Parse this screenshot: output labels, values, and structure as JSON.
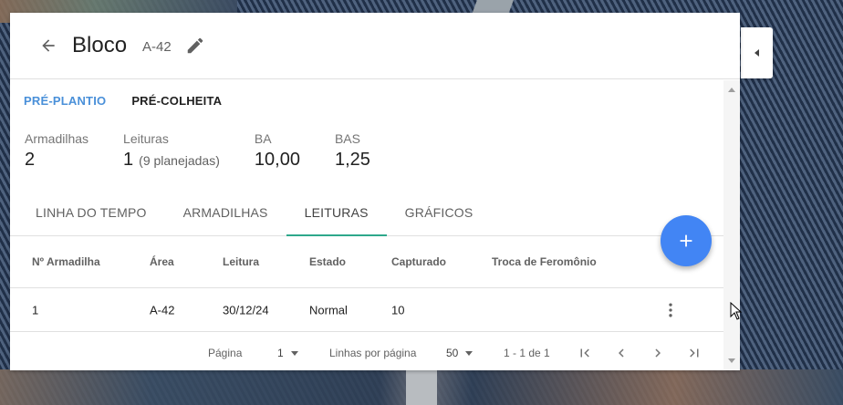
{
  "header": {
    "title": "Bloco",
    "code": "A-42"
  },
  "phase_tabs": [
    {
      "label": "PRÉ-PLANTIO",
      "active": true
    },
    {
      "label": "PRÉ-COLHEITA",
      "active": false
    }
  ],
  "stats": [
    {
      "label": "Armadilhas",
      "value": "2",
      "note": ""
    },
    {
      "label": "Leituras",
      "value": "1",
      "note": "(9 planejadas)"
    },
    {
      "label": "BA",
      "value": "10,00",
      "note": ""
    },
    {
      "label": "BAS",
      "value": "1,25",
      "note": ""
    }
  ],
  "tabs": [
    {
      "label": "LINHA DO TEMPO",
      "active": false
    },
    {
      "label": "ARMADILHAS",
      "active": false
    },
    {
      "label": "LEITURAS",
      "active": true
    },
    {
      "label": "GRÁFICOS",
      "active": false
    }
  ],
  "table": {
    "columns": [
      "Nº Armadilha",
      "Área",
      "Leitura",
      "Estado",
      "Capturado",
      "Troca de Feromônio"
    ],
    "rows": [
      [
        "1",
        "A-42",
        "30/12/24",
        "Normal",
        "10",
        ""
      ]
    ]
  },
  "pagination": {
    "page_label": "Página",
    "page_value": "1",
    "rows_per_page_label": "Linhas por página",
    "rows_per_page_value": "50",
    "range_text": "1 - 1 de 1"
  },
  "colors": {
    "accent": "#4a90d9",
    "fab": "#4285f4",
    "active_tab_indicator": "#2ea88b"
  },
  "icons": {
    "back": "arrow-back-icon",
    "edit": "pencil-icon",
    "fab": "plus-icon",
    "row_menu": "more-vertical-icon",
    "first": "first-page-icon",
    "prev": "chevron-left-icon",
    "next": "chevron-right-icon",
    "last": "last-page-icon",
    "side_toggle": "caret-left-icon"
  }
}
